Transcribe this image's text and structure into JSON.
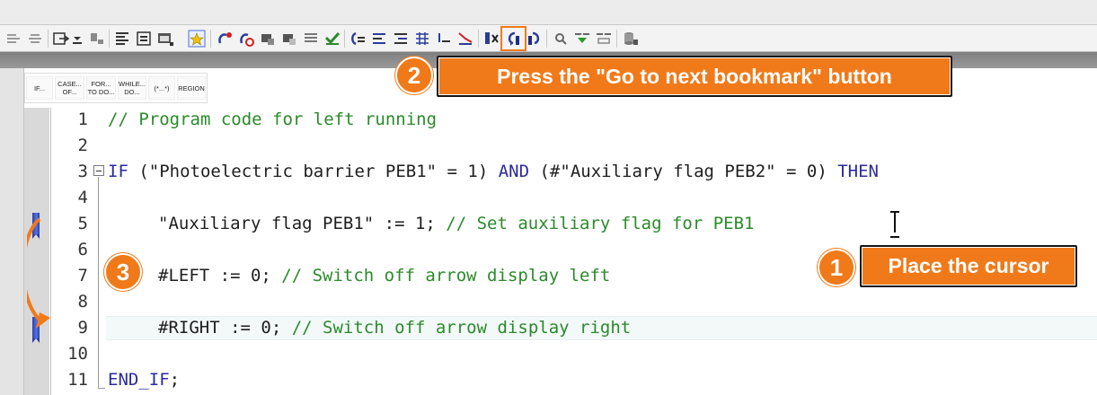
{
  "snippets": [
    {
      "label": "IF..."
    },
    {
      "label": "CASE... OF..."
    },
    {
      "label": "FOR... TO DO..."
    },
    {
      "label": "WHILE... DO..."
    },
    {
      "label": "(*...*)"
    },
    {
      "label": "REGION"
    }
  ],
  "toolbar": {
    "icons": [
      "indent-icon",
      "outdent-icon",
      "insert-icon",
      "expand-icon",
      "tag-icon",
      "list-icon",
      "list-alt-icon",
      "window-icon",
      "favorites-icon",
      "instruction-icon",
      "stop-icon",
      "comment-icon",
      "uncomment-icon",
      "table-icon",
      "check-icon",
      "prev-jump-icon",
      "align-icon",
      "align-right-icon",
      "grid-icon",
      "line-icon",
      "line-alt-icon",
      "bookmark-set-icon",
      "next-bookmark-icon",
      "prev-bookmark-icon",
      "search-icon",
      "monitor-icon",
      "monitor-alt-icon",
      "database-icon"
    ]
  },
  "editor": {
    "lines": [
      {
        "num": "1",
        "text": "// Program code for left running"
      },
      {
        "num": "2",
        "text": ""
      },
      {
        "num": "3",
        "text": "IF (\"Photoelectric barrier PEB1\" = 1) AND (#\"Auxiliary flag PEB2\" = 0) THEN"
      },
      {
        "num": "4",
        "text": ""
      },
      {
        "num": "5",
        "text": "\"Auxiliary flag PEB1\" := 1; // Set auxiliary flag for PEB1"
      },
      {
        "num": "6",
        "text": ""
      },
      {
        "num": "7",
        "text": "#LEFT := 0; // Switch off arrow display left"
      },
      {
        "num": "8",
        "text": ""
      },
      {
        "num": "9",
        "text": "#RIGHT := 0; // Switch off arrow display right"
      },
      {
        "num": "10",
        "text": ""
      },
      {
        "num": "11",
        "text": "END_IF;"
      }
    ],
    "bookmarked_lines": [
      "5",
      "9"
    ]
  },
  "callouts": [
    {
      "number": "1",
      "text": "Place the cursor"
    },
    {
      "number": "2",
      "text": "Press the \"Go to next bookmark\" button"
    },
    {
      "number": "3",
      "text": ""
    }
  ],
  "colors": {
    "accent": "#f07a1a",
    "keyword": "#2a2aa0",
    "comment": "#2a8a2a",
    "bookmark": "#3350c8"
  }
}
